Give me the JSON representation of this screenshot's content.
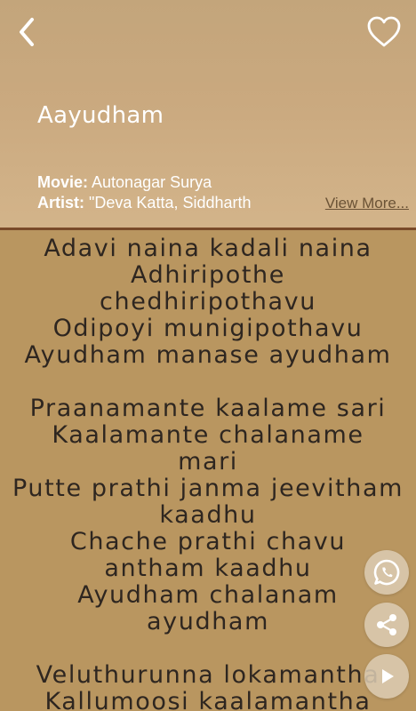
{
  "header": {
    "title": "Aayudham",
    "movie_label": "Movie:",
    "movie_value": "Autonagar Surya",
    "artist_label": "Artist:",
    "artist_value": "\"Deva Katta, Siddharth",
    "view_more": "View More..."
  },
  "icons": {
    "back": "back-arrow-icon",
    "favorite": "heart-outline-icon",
    "whatsapp": "whatsapp-icon",
    "share": "share-icon",
    "play": "play-icon"
  },
  "lyrics": "Adavi naina kadali naina\nAdhiripothe\nchedhiripothavu\nOdipoyi munigipothavu\nAyudham manase ayudham\n\nPraanamante kaalame sari\nKaalamante chalaname\nmari\nPutte prathi janma jeevitham\nkaadhu\nChache prathi chavu\nantham kaadhu\nAyudham chalanam\nayudham\n\nVeluthurunna lokamantha\nKallumoosi kaalamantha",
  "colors": {
    "header_bg": "#caa97f",
    "lyrics_bg": "#b99660",
    "divider": "#7a4b2a",
    "lyrics_text": "#2e2620",
    "link": "#6b5336"
  }
}
